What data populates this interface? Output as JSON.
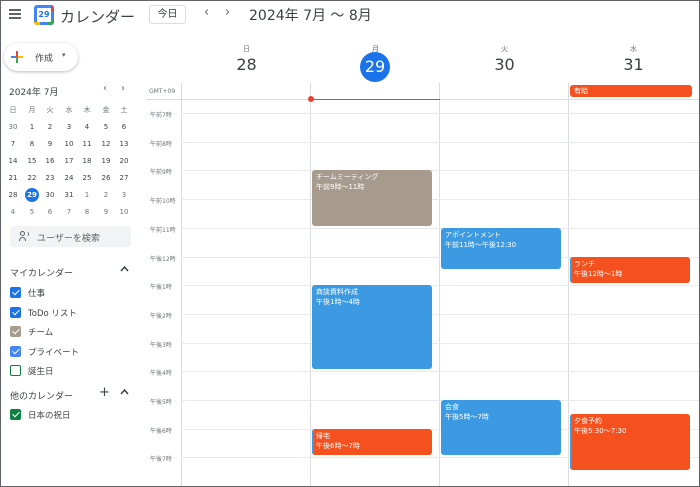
{
  "header": {
    "menu_icon": "hamburger-icon",
    "logo_number": "29",
    "app_title": "カレンダー",
    "today_button": "今日",
    "prev_icon": "‹",
    "next_icon": "›",
    "date_range": "2024年 7月 〜 8月"
  },
  "sidebar": {
    "create_button": "作成",
    "create_caret": "▾",
    "mini_calendar": {
      "title": "2024年 7月",
      "prev": "‹",
      "next": "›",
      "weekdays": [
        "日",
        "月",
        "火",
        "水",
        "木",
        "金",
        "土"
      ],
      "weeks": [
        [
          "30",
          "1",
          "2",
          "3",
          "4",
          "5",
          "6"
        ],
        [
          "7",
          "8",
          "9",
          "10",
          "11",
          "12",
          "13"
        ],
        [
          "14",
          "15",
          "16",
          "17",
          "18",
          "19",
          "20"
        ],
        [
          "21",
          "22",
          "23",
          "24",
          "25",
          "26",
          "27"
        ],
        [
          "28",
          "29",
          "30",
          "31",
          "1",
          "2",
          "3"
        ],
        [
          "4",
          "5",
          "6",
          "7",
          "8",
          "9",
          "10"
        ]
      ],
      "today": "29"
    },
    "people_search": "ユーザーを検索",
    "my_calendars_title": "マイカレンダー",
    "my_calendars": [
      {
        "label": "仕事",
        "color": "#1a73e8",
        "checked": true
      },
      {
        "label": "ToDo リスト",
        "color": "#1a73e8",
        "checked": true
      },
      {
        "label": "チーム",
        "color": "#a79b8e",
        "checked": true
      },
      {
        "label": "プライベート",
        "color": "#4285f4",
        "checked": true
      },
      {
        "label": "誕生日",
        "color": "#0b8043",
        "checked": false
      }
    ],
    "other_calendars_title": "他のカレンダー",
    "other_calendars": [
      {
        "label": "日本の祝日",
        "color": "#0b8043",
        "checked": true
      }
    ],
    "toggle_up": "^",
    "add_icon": "+"
  },
  "main": {
    "timezone": "GMT+09",
    "days": [
      {
        "dow": "日",
        "date": "28",
        "today": false
      },
      {
        "dow": "月",
        "date": "29",
        "today": true
      },
      {
        "dow": "火",
        "date": "30",
        "today": false
      },
      {
        "dow": "水",
        "date": "31",
        "today": false
      }
    ],
    "hours": [
      "午前7時",
      "午前8時",
      "午前9時",
      "午前10時",
      "午前11時",
      "午後12時",
      "午後1時",
      "午後2時",
      "午後3時",
      "午後4時",
      "午後5時",
      "午後6時",
      "午後7時"
    ],
    "events": [
      {
        "day": 3,
        "title": "有給",
        "time": "",
        "all_day": true,
        "color": "#f4511e"
      },
      {
        "day": 1,
        "title": "チームミーティング",
        "time": "午前9時〜11時",
        "all_day": false,
        "color": "#a79b8e"
      },
      {
        "day": 2,
        "title": "アポイントメント",
        "time": "午前11時〜午後12:30",
        "all_day": false,
        "color": "#3b9ae1"
      },
      {
        "day": 3,
        "title": "ランチ",
        "time": "午後12時〜1時",
        "all_day": false,
        "color": "#f4511e"
      },
      {
        "day": 1,
        "title": "商談資料作成",
        "time": "午後1時〜4時",
        "all_day": false,
        "color": "#3b9ae1"
      },
      {
        "day": 2,
        "title": "会食",
        "time": "午後5時〜7時",
        "all_day": false,
        "color": "#3b9ae1"
      },
      {
        "day": 3,
        "title": "夕食予約",
        "time": "午後5:30〜7:30",
        "all_day": false,
        "color": "#f4511e"
      },
      {
        "day": 1,
        "title": "帰宅",
        "time": "午後6時〜7時",
        "all_day": false,
        "color": "#f4511e"
      }
    ]
  }
}
